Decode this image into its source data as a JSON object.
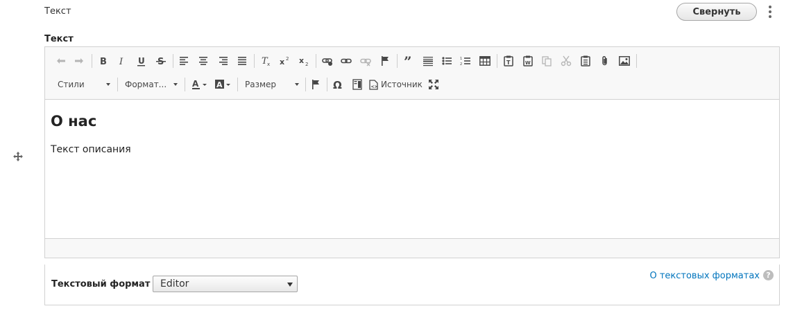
{
  "header": {
    "label": "Текст",
    "collapse_button": "Свернуть"
  },
  "field": {
    "label": "Текст"
  },
  "toolbar": {
    "styles_label": "Стили",
    "format_label": "Формат...",
    "size_label": "Размер",
    "source_label": "Источник"
  },
  "content": {
    "heading": "О нас",
    "paragraph": "Текст описания"
  },
  "text_format": {
    "label": "Текстовый формат",
    "selected": "Editor",
    "help_link": "О текстовых форматах",
    "help_icon": "?"
  },
  "colors": {
    "link": "#0074bd",
    "border": "#d1d1d1",
    "toolbar_bg": "#f8f8f8"
  }
}
